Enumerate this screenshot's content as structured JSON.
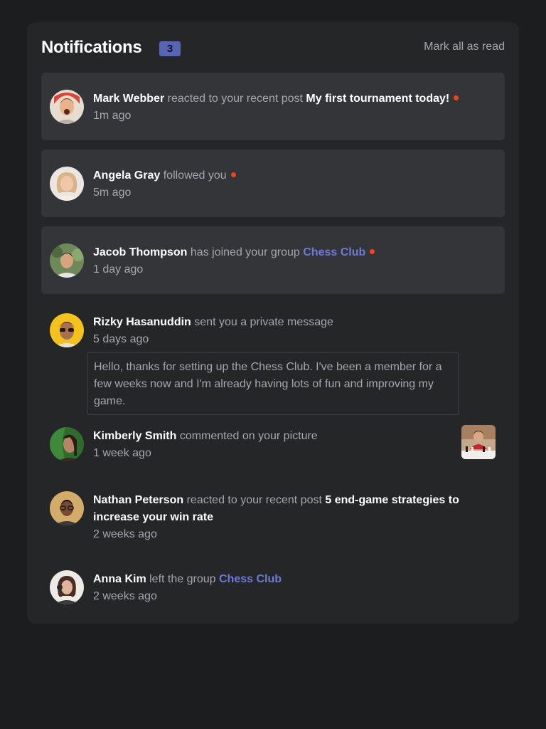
{
  "header": {
    "title": "Notifications",
    "unread_count": "3",
    "mark_all_label": "Mark all as read"
  },
  "notifications": [
    {
      "name": "Mark Webber",
      "action": "reacted to your recent post",
      "post": "My first tournament today!",
      "time": "1m ago",
      "unread": true,
      "avatar": "mark-webber-avatar"
    },
    {
      "name": "Angela Gray",
      "action": "followed you",
      "time": "5m ago",
      "unread": true,
      "avatar": "angela-gray-avatar"
    },
    {
      "name": "Jacob Thompson",
      "action": "has joined your group",
      "group": "Chess Club",
      "time": "1 day ago",
      "unread": true,
      "avatar": "jacob-thompson-avatar"
    },
    {
      "name": "Rizky Hasanuddin",
      "action": "sent you a private message",
      "time": "5 days ago",
      "unread": false,
      "message": "Hello, thanks for setting up the Chess Club. I've been a member for a few weeks now and I'm already having lots of fun and improving my game.",
      "avatar": "rizky-hasanuddin-avatar"
    },
    {
      "name": "Kimberly Smith",
      "action": "commented on your picture",
      "time": "1 week ago",
      "unread": false,
      "avatar": "kimberly-smith-avatar",
      "picture": "chess-picture-thumbnail"
    },
    {
      "name": "Nathan Peterson",
      "action": "reacted to your recent post",
      "post": "5 end-game strategies to increase your win rate",
      "time": "2 weeks ago",
      "unread": false,
      "avatar": "nathan-peterson-avatar"
    },
    {
      "name": "Anna Kim",
      "action": "left the group",
      "group": "Chess Club",
      "time": "2 weeks ago",
      "unread": false,
      "avatar": "anna-kim-avatar"
    }
  ],
  "colors": {
    "background": "#1c1d1f",
    "card": "#252628",
    "unread_row": "#343538",
    "accent": "#5864b4",
    "group_link": "#6e7ad8",
    "unread_dot": "#f0441a",
    "muted_text": "#a3a7b0"
  }
}
